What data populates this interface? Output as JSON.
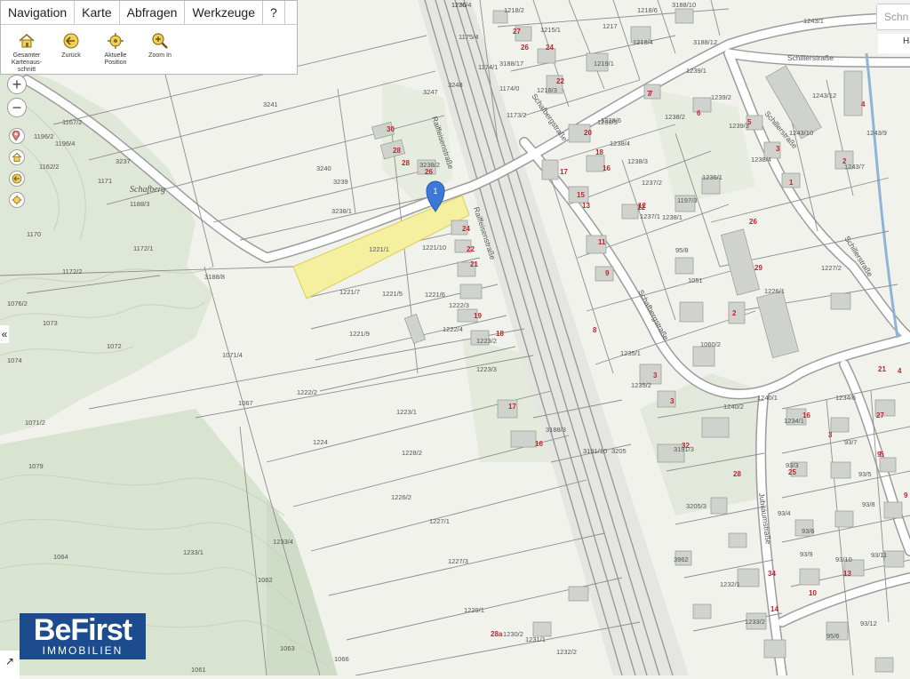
{
  "toolbar": {
    "tabs": [
      {
        "label": "Navigation",
        "active": true
      },
      {
        "label": "Karte",
        "active": false
      },
      {
        "label": "Abfragen",
        "active": false
      },
      {
        "label": "Werkzeuge",
        "active": false
      },
      {
        "label": "?",
        "active": false
      }
    ],
    "tools": [
      {
        "label": "Gesamter Kartenaus-schnitt",
        "icon": "home-icon"
      },
      {
        "label": "Zurück",
        "icon": "back-arrow-icon"
      },
      {
        "label": "Aktuelle Position",
        "icon": "locate-icon"
      },
      {
        "label": "Zoom In",
        "icon": "magnifier-icon"
      }
    ]
  },
  "zoom": {
    "in": "+",
    "out": "−"
  },
  "search": {
    "placeholder": "Schn"
  },
  "top_right_label": "Ha",
  "collapse_label": "«",
  "logo": {
    "line1": "BeFirst",
    "line2": "IMMOBILIEN"
  },
  "colors": {
    "highlight": "#f4f0a0",
    "marker": "#3b78d8",
    "logo_bg": "#1c4b8e",
    "house_number": "#c0262f"
  },
  "map": {
    "marker_label": "1",
    "streets": [
      "Schillerstraße",
      "Raiffeisenstraße",
      "Schafbergstraße",
      "Jubiläumstraße",
      "Schafberg"
    ],
    "parcels": [
      "1176/4",
      "1218/2",
      "1218/6",
      "3188/10",
      "1243/1",
      "1215/1",
      "1217",
      "1218/4",
      "3188/12",
      "1175/4",
      "1174/1",
      "3188/17",
      "1219/1",
      "1239/1",
      "1174/0",
      "1218/3",
      "1173/2",
      "3247",
      "3248",
      "3241",
      "1239/2",
      "1243/12",
      "1239/3",
      "1238/5",
      "1238/2",
      "1238/4",
      "1238/3",
      "1243/10",
      "1238/4",
      "1243/9",
      "1243/7",
      "1167/2",
      "1196/2",
      "1196/4",
      "3237",
      "3240",
      "3238/2",
      "3239",
      "3238/1",
      "1162/2",
      "1171",
      "1188/3",
      "1170",
      "1172/1",
      "1237/2",
      "1237/1",
      "1238/1",
      "1236/1",
      "1238/6",
      "1197/3",
      "1172/2",
      "3188/8",
      "1221/1",
      "1221/10",
      "1221/7",
      "1221/5",
      "1221/6",
      "1222/3",
      "1223/2",
      "1223/1",
      "1228/2",
      "1222/4",
      "1221/9",
      "1223/3",
      "1073",
      "1076/2",
      "1072",
      "1071/4",
      "1074",
      "1067",
      "1222/2",
      "1071/2",
      "1224",
      "1079",
      "1226/2",
      "1227/1",
      "1227/3",
      "1229/1",
      "1230/2",
      "1231/1",
      "1232/2",
      "1233/4",
      "1233/1",
      "1062",
      "1064",
      "1063",
      "1066",
      "1061",
      "1060/2",
      "1051",
      "1235/1",
      "1235/2",
      "1226/1",
      "1227/2",
      "1240/1",
      "1240/2",
      "3191/3",
      "3188/3",
      "3191/10",
      "3205",
      "3205/3",
      "3962",
      "1232/1",
      "1233/2",
      "1234/6",
      "1234/1",
      "93/7",
      "93/3",
      "93/5",
      "93/4",
      "93/6",
      "93/8",
      "93/9",
      "93/10",
      "93/11",
      "93/12",
      "95/6",
      "95/8",
      "1236"
    ],
    "house_numbers": [
      "27",
      "26",
      "24",
      "22",
      "28",
      "7",
      "6",
      "30",
      "28",
      "26",
      "20",
      "18",
      "16",
      "17",
      "15",
      "13",
      "12",
      "11",
      "9",
      "8",
      "5",
      "3",
      "4",
      "2",
      "1",
      "24",
      "22",
      "21",
      "19",
      "18",
      "17",
      "16",
      "3",
      "7",
      "2",
      "29",
      "26",
      "21",
      "16",
      "25",
      "27",
      "3",
      "5",
      "9",
      "10",
      "14",
      "34",
      "32",
      "28",
      "28a",
      "12",
      "13",
      "9",
      "4",
      "3"
    ]
  }
}
